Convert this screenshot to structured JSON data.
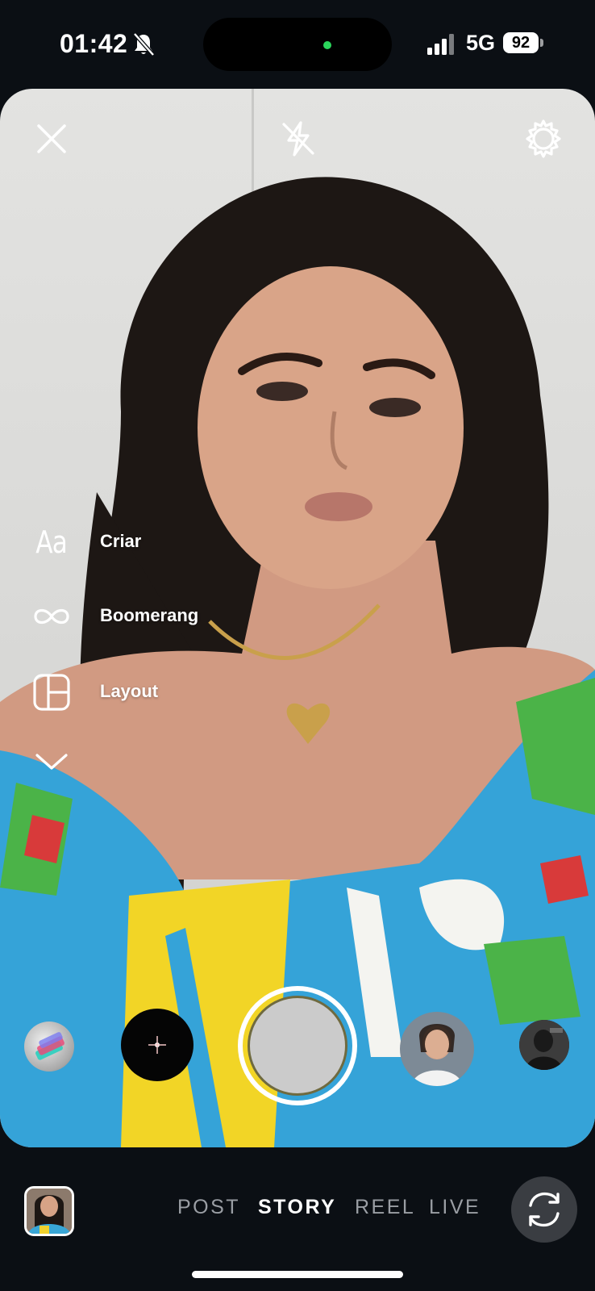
{
  "status_bar": {
    "time": "01:42",
    "network": "5G",
    "battery": "92",
    "icons": [
      "bell-slash-icon",
      "signal-bars-icon",
      "battery-icon"
    ]
  },
  "camera": {
    "top_controls": [
      "close-icon",
      "flash-off-icon",
      "gear-icon"
    ],
    "menu": [
      {
        "icon": "text-aa-icon",
        "label": "Criar"
      },
      {
        "icon": "infinity-icon",
        "label": "Boomerang"
      },
      {
        "icon": "layout-grid-icon",
        "label": "Layout"
      },
      {
        "icon": "chevron-down-icon",
        "label": ""
      }
    ],
    "effects": [
      "effect-gradient",
      "effect-sparkle",
      "effect-selfie",
      "effect-photo"
    ]
  },
  "bottom_bar": {
    "modes": [
      "POST",
      "STORY",
      "REEL",
      "LIVE"
    ],
    "active_mode": "STORY",
    "icons": [
      "gallery-thumbnail",
      "camera-flip-icon"
    ]
  },
  "colors": {
    "background": "#0b0f14",
    "shutter_ring": "#ffffff",
    "inactive_tab": "#9a9ea4",
    "active_tab": "#ffffff"
  }
}
